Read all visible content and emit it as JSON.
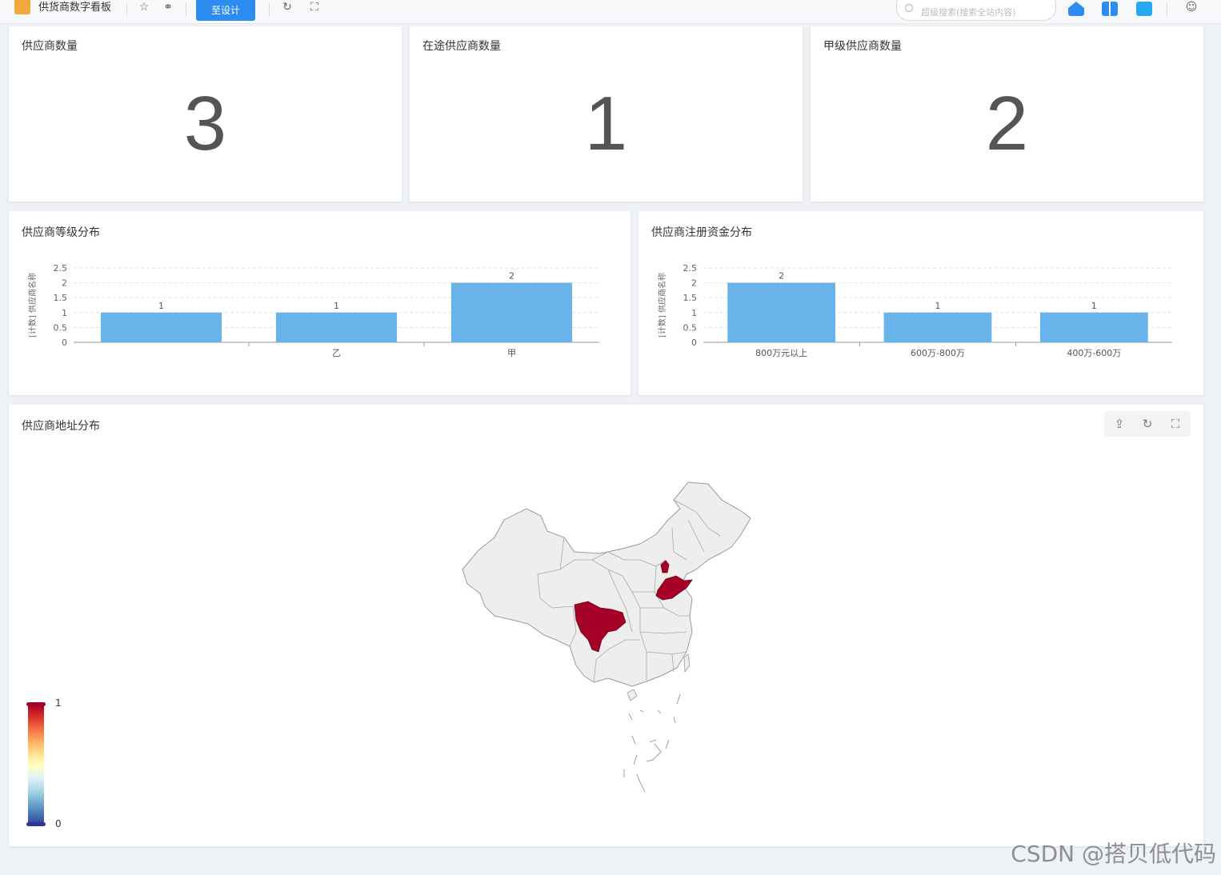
{
  "topbar": {
    "app_title": "供货商数字看板",
    "design_button": "至设计",
    "search_placeholder": "超级搜索(搜索全站内容)",
    "colors": {
      "home": "#2d8cf0",
      "grid": "#2d8cf0",
      "check": "#29a8ef"
    }
  },
  "kpis": [
    {
      "title": "供应商数量",
      "value": "3"
    },
    {
      "title": "在途供应商数量",
      "value": "1"
    },
    {
      "title": "甲级供应商数量",
      "value": "2"
    }
  ],
  "grade_chart": {
    "title": "供应商等级分布",
    "chart_data": {
      "type": "bar",
      "categories": [
        "",
        "乙",
        "甲"
      ],
      "values": [
        1,
        1,
        2
      ],
      "ylabel": "[计数] 供应商名称",
      "ylim": [
        0,
        2.5
      ],
      "yticks": [
        0,
        0.5,
        1,
        1.5,
        2,
        2.5
      ],
      "ytick_labels": [
        "0",
        "0.5",
        "1",
        "1.5",
        "2",
        "2.5"
      ],
      "data_labels": [
        "1",
        "1",
        "2"
      ],
      "bar_color": "#67b3ea",
      "grid": true
    }
  },
  "capital_chart": {
    "title": "供应商注册资金分布",
    "chart_data": {
      "type": "bar",
      "categories": [
        "800万元以上",
        "600万-800万",
        "400万-600万"
      ],
      "values": [
        2,
        1,
        1
      ],
      "ylabel": "[计数] 供应商名称",
      "ylim": [
        0,
        2.5
      ],
      "yticks": [
        0,
        0.5,
        1,
        1.5,
        2,
        2.5
      ],
      "ytick_labels": [
        "0",
        "0.5",
        "1",
        "1.5",
        "2",
        "2.5"
      ],
      "data_labels": [
        "2",
        "1",
        "1"
      ],
      "bar_color": "#67b3ea",
      "grid": true
    }
  },
  "map": {
    "title": "供应商地址分布",
    "tools": [
      "export-icon",
      "refresh-icon",
      "fullscreen-icon"
    ],
    "legend": {
      "max_label": "1",
      "min_label": "0",
      "max_color": "#a50026",
      "min_color": "#313695"
    },
    "highlight_color": "#a50026",
    "base_color": "#eeeeee"
  },
  "watermark": "CSDN @搭贝低代码"
}
